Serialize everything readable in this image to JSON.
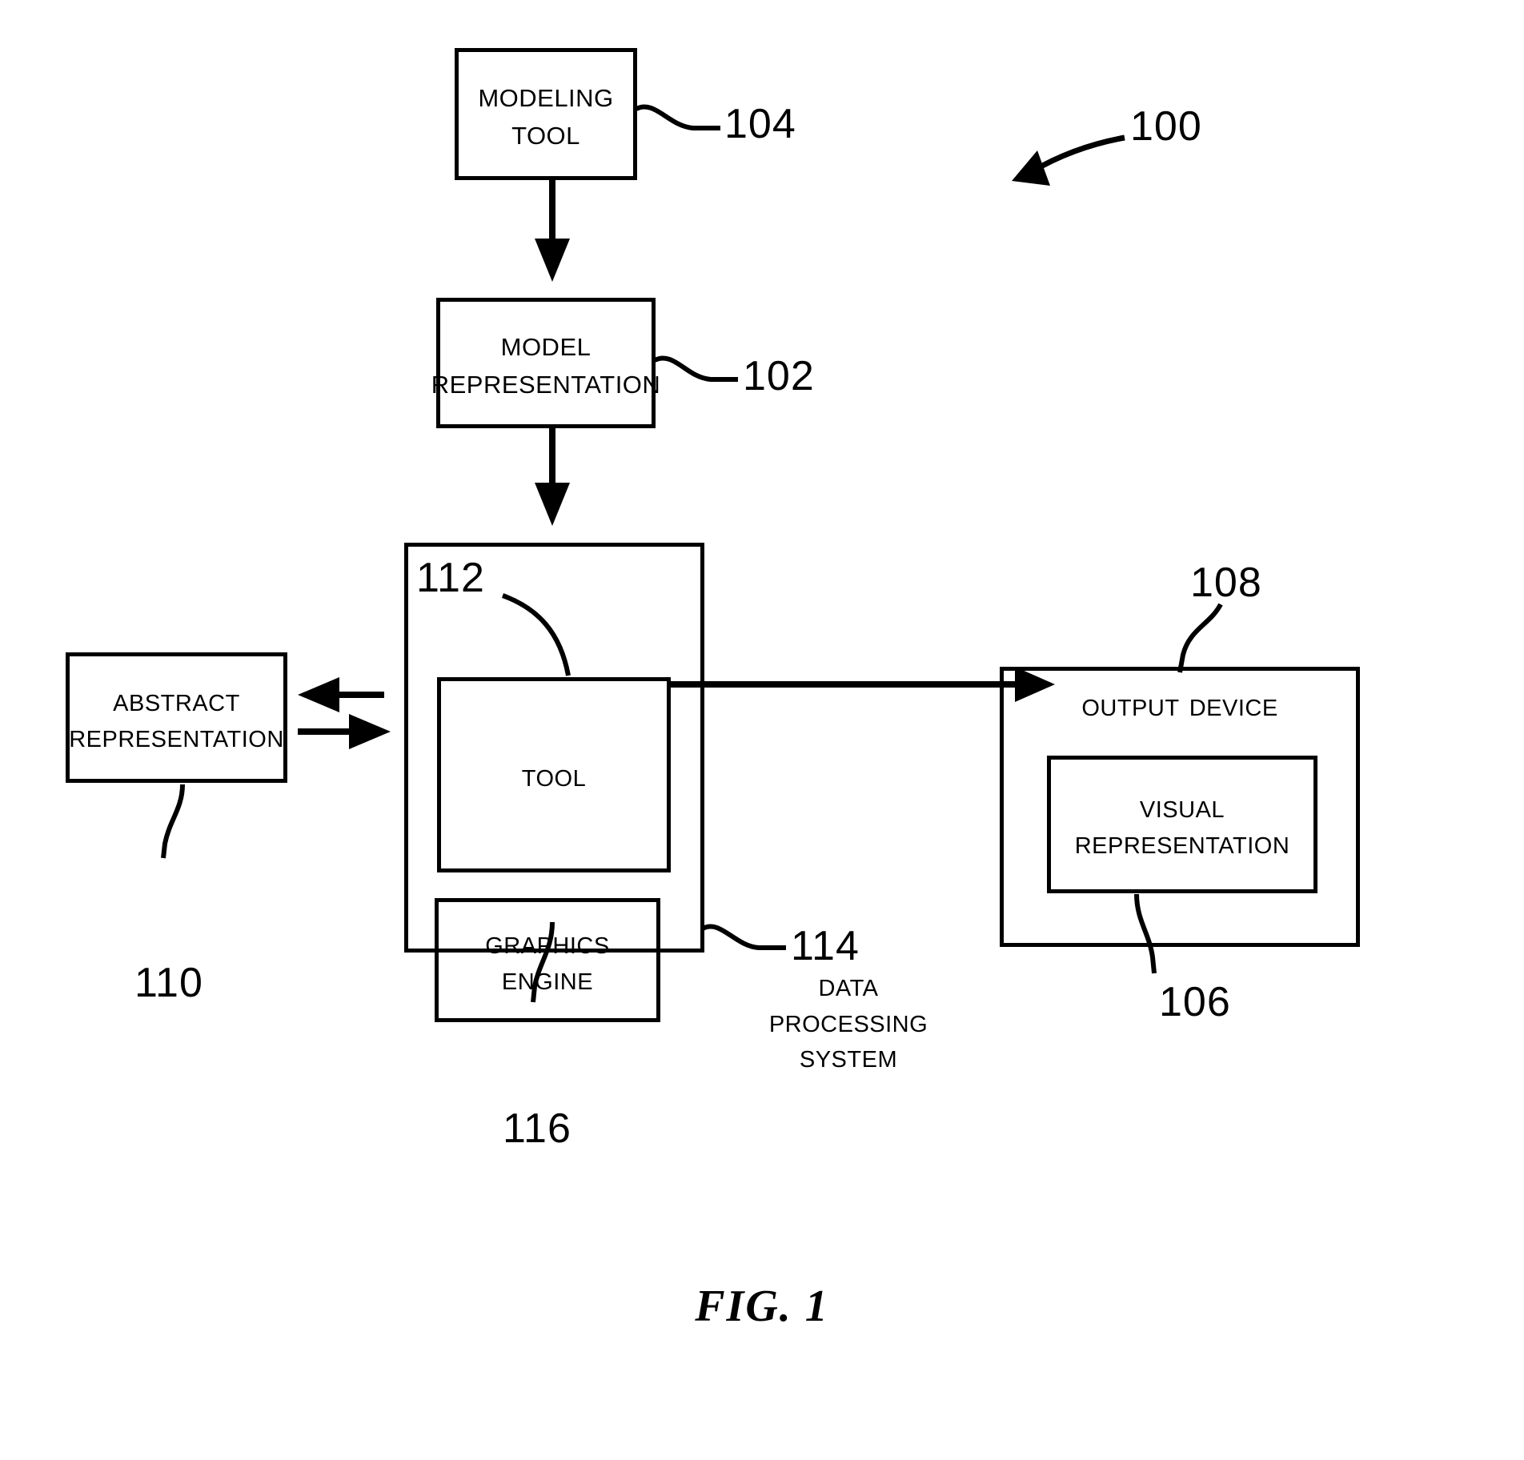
{
  "figure": {
    "caption": "FIG. 1",
    "system_ref": "100"
  },
  "nodes": {
    "modeling_tool": {
      "label": "Modeling\nTool",
      "ref": "104"
    },
    "model_representation": {
      "label": "Model\nRepresentation",
      "ref": "102"
    },
    "data_processing_system": {
      "label": "Data\nProcessing\nSystem",
      "ref": "114"
    },
    "tool": {
      "label": "Tool",
      "ref": "112"
    },
    "graphics_engine": {
      "label": "Graphics\nEngine",
      "ref": "116"
    },
    "abstract_representation": {
      "label": "Abstract\nRepresentation",
      "ref": "110"
    },
    "output_device": {
      "label": "Output Device",
      "ref": "108"
    },
    "visual_representation": {
      "label": "Visual\nRepresentation",
      "ref": "106"
    }
  },
  "connectors": [
    {
      "name": "modeling-tool-to-model-representation",
      "kind": "arrow-down"
    },
    {
      "name": "model-representation-to-data-processing-system",
      "kind": "arrow-down"
    },
    {
      "name": "tool-to-visual-representation",
      "kind": "arrow-right"
    },
    {
      "name": "data-processing-system-to-abstract-representation",
      "kind": "arrow-left"
    },
    {
      "name": "abstract-representation-to-data-processing-system",
      "kind": "arrow-right"
    }
  ],
  "style": {
    "stroke": "#000000",
    "background": "#ffffff"
  }
}
